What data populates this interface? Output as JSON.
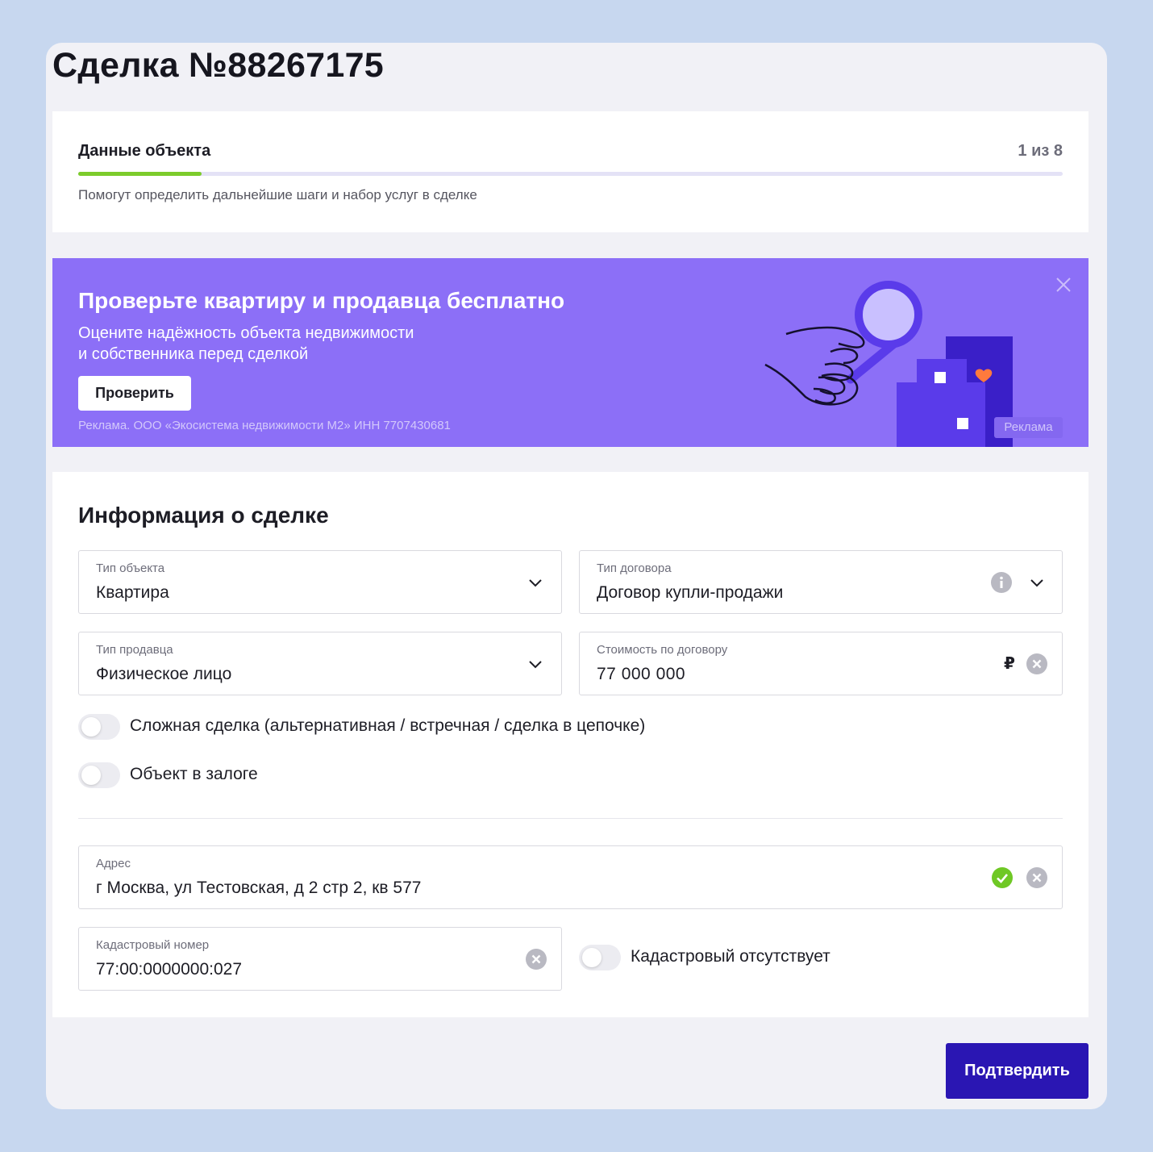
{
  "deal": {
    "title": "Сделка №88267175"
  },
  "step": {
    "title": "Данные объекта",
    "counter": "1 из 8",
    "progress_fraction": 0.125,
    "subtitle": "Помогут определить дальнейшие шаги и набор услуг в сделке"
  },
  "promo": {
    "title": "Проверьте квартиру и продавца бесплатно",
    "text_line1": "Оцените надёжность объекта недвижимости",
    "text_line2": "и собственника перед сделкой",
    "button_label": "Проверить",
    "legal": "Реклама. ООО «Экосистема недвижимости М2» ИНН 7707430681",
    "ad_label": "Реклама",
    "close_icon": "close-icon",
    "colors": {
      "background": "#8c6ff7",
      "heart": "#ff7a3d"
    }
  },
  "info": {
    "title": "Информация о сделке",
    "object_type": {
      "label": "Тип объекта",
      "value": "Квартира",
      "icon": "chevron-down-icon"
    },
    "contract_type": {
      "label": "Тип договора",
      "value": "Договор купли-продажи",
      "icons": [
        "info-icon",
        "chevron-down-icon"
      ]
    },
    "seller_type": {
      "label": "Тип продавца",
      "value": "Физическое лицо",
      "icon": "chevron-down-icon"
    },
    "price": {
      "label": "Стоимость по договору",
      "value": "77 000 000",
      "currency": "₽",
      "icon": "clear-icon"
    },
    "complex_deal": {
      "label": "Сложная сделка (альтернативная / встречная / сделка в цепочке)",
      "on": false
    },
    "pledge": {
      "label": "Объект в залоге",
      "on": false
    },
    "address": {
      "label": "Адрес",
      "value": "г Москва, ул Тестовская, д 2 стр 2, кв 577",
      "icons": [
        "check-circle-icon",
        "clear-icon"
      ]
    },
    "cadastral": {
      "label": "Кадастровый номер",
      "value": "77:00:0000000:027",
      "icon": "clear-icon"
    },
    "cadastral_missing": {
      "label": "Кадастровый отсутствует",
      "on": false
    }
  },
  "actions": {
    "confirm_label": "Подтвердить"
  },
  "colors": {
    "accent": "#2a16b3",
    "success": "#7ccc2b",
    "page_bg": "#c7d7ef"
  }
}
